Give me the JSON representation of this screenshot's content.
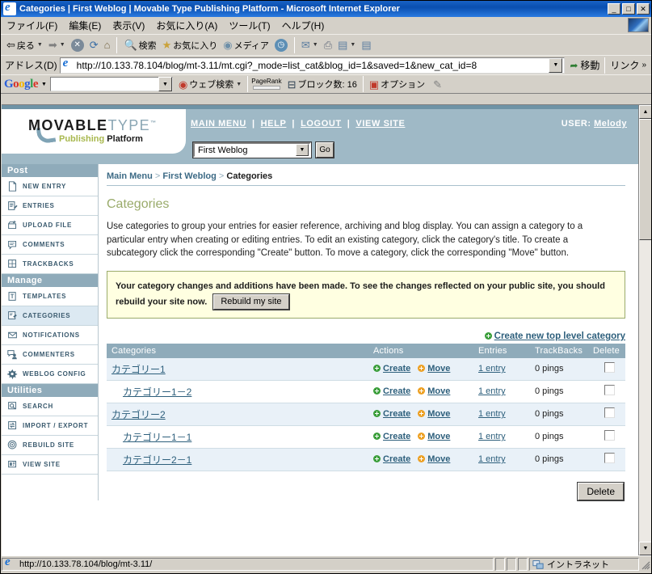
{
  "window": {
    "title": "Categories | First Weblog | Movable Type Publishing Platform - Microsoft Internet Explorer",
    "minimize": "_",
    "maximize": "□",
    "close": "✕"
  },
  "menubar": {
    "items": [
      {
        "label": "ファイル(F)"
      },
      {
        "label": "編集(E)"
      },
      {
        "label": "表示(V)"
      },
      {
        "label": "お気に入り(A)"
      },
      {
        "label": "ツール(T)"
      },
      {
        "label": "ヘルプ(H)"
      }
    ]
  },
  "toolbar": {
    "back": "戻る",
    "forward": "",
    "stop": "✕",
    "refresh": "⟳",
    "home": "⌂",
    "search": "検索",
    "favorites": "お気に入り",
    "media": "メディア",
    "history": "",
    "mail": "",
    "print": "",
    "edit": "",
    "discuss": ""
  },
  "address": {
    "label": "アドレス(D)",
    "value": "http://10.133.78.104/blog/mt-3.11/mt.cgi?_mode=list_cat&blog_id=1&saved=1&new_cat_id=8",
    "go": "移動",
    "links": "リンク",
    "chevron": "»"
  },
  "google_bar": {
    "logo": "Google",
    "search_value": "",
    "web_search": "ウェブ検索",
    "pagerank_label": "PageRank",
    "blocked": "ブロック数: 16",
    "options": "オプション"
  },
  "mt_header": {
    "logo_movable": "MOVABLE",
    "logo_type": "TYPE",
    "logo_tm": "™",
    "logo_publishing": "Publishing",
    "logo_platform": "Platform",
    "nav": [
      {
        "label": "MAIN MENU"
      },
      {
        "label": "HELP"
      },
      {
        "label": "LOGOUT"
      },
      {
        "label": "VIEW SITE"
      }
    ],
    "nav_separator": "|",
    "user_label": "USER:",
    "user_name": "Melody",
    "blog_selected": "First Weblog",
    "go_button": "Go"
  },
  "sidebar": {
    "sections": [
      {
        "title": "Post",
        "items": [
          {
            "label": "NEW ENTRY",
            "icon": "page-icon",
            "active": false
          },
          {
            "label": "ENTRIES",
            "icon": "entries-icon",
            "active": false
          },
          {
            "label": "UPLOAD FILE",
            "icon": "upload-icon",
            "active": false
          },
          {
            "label": "COMMENTS",
            "icon": "comment-icon",
            "active": false
          },
          {
            "label": "TRACKBACKS",
            "icon": "trackback-icon",
            "active": false
          }
        ]
      },
      {
        "title": "Manage",
        "items": [
          {
            "label": "TEMPLATES",
            "icon": "template-icon",
            "active": false
          },
          {
            "label": "CATEGORIES",
            "icon": "categories-icon",
            "active": true
          },
          {
            "label": "NOTIFICATIONS",
            "icon": "envelope-icon",
            "active": false
          },
          {
            "label": "COMMENTERS",
            "icon": "commenters-icon",
            "active": false
          },
          {
            "label": "WEBLOG CONFIG",
            "icon": "gear-icon",
            "active": false
          }
        ]
      },
      {
        "title": "Utilities",
        "items": [
          {
            "label": "SEARCH",
            "icon": "search-icon",
            "active": false
          },
          {
            "label": "IMPORT / EXPORT",
            "icon": "import-export-icon",
            "active": false
          },
          {
            "label": "REBUILD SITE",
            "icon": "rebuild-icon",
            "active": false
          },
          {
            "label": "VIEW SITE",
            "icon": "view-site-icon",
            "active": false
          }
        ]
      }
    ]
  },
  "main": {
    "breadcrumb": {
      "main_menu": "Main Menu",
      "sep1": ">",
      "weblog": "First Weblog",
      "sep2": ">",
      "current": "Categories"
    },
    "page_title": "Categories",
    "description": "Use categories to group your entries for easier reference, archiving and blog display. You can assign a category to a particular entry when creating or editing entries. To edit an existing category, click the category's title. To create a subcategory click the corresponding \"Create\" button. To move a category, click the corresponding \"Move\" button.",
    "notice_text": "Your category changes and additions have been made. To see the changes reflected on your public site, you should rebuild your site now.",
    "rebuild_button": "Rebuild my site",
    "create_top_level": "Create new top level category",
    "table": {
      "headers": {
        "categories": "Categories",
        "actions": "Actions",
        "entries": "Entries",
        "trackbacks": "TrackBacks",
        "delete": "Delete"
      },
      "rows": [
        {
          "name": "カテゴリー1",
          "indent": false,
          "create": "Create",
          "move": "Move",
          "entries": "1 entry",
          "pings": "0 pings"
        },
        {
          "name": "カテゴリー1－2",
          "indent": true,
          "create": "Create",
          "move": "Move",
          "entries": "1 entry",
          "pings": "0 pings"
        },
        {
          "name": "カテゴリー2",
          "indent": false,
          "create": "Create",
          "move": "Move",
          "entries": "1 entry",
          "pings": "0 pings"
        },
        {
          "name": "カテゴリー1－1",
          "indent": true,
          "create": "Create",
          "move": "Move",
          "entries": "1 entry",
          "pings": "0 pings"
        },
        {
          "name": "カテゴリー2－1",
          "indent": true,
          "create": "Create",
          "move": "Move",
          "entries": "1 entry",
          "pings": "0 pings"
        }
      ]
    },
    "delete_button": "Delete"
  },
  "statusbar": {
    "url": "http://10.133.78.104/blog/mt-3.11/",
    "zone": "イントラネット"
  },
  "colors": {
    "mt_blue": "#9fb9c6",
    "mt_dark_blue": "#6e93a6",
    "row_alt": "#e9f1f8",
    "notice_bg": "#ffffe1",
    "notice_border": "#9aab6b",
    "title_green": "#9aab6b",
    "link": "#2d5f7c",
    "titlebar": "#0a4fb0"
  }
}
